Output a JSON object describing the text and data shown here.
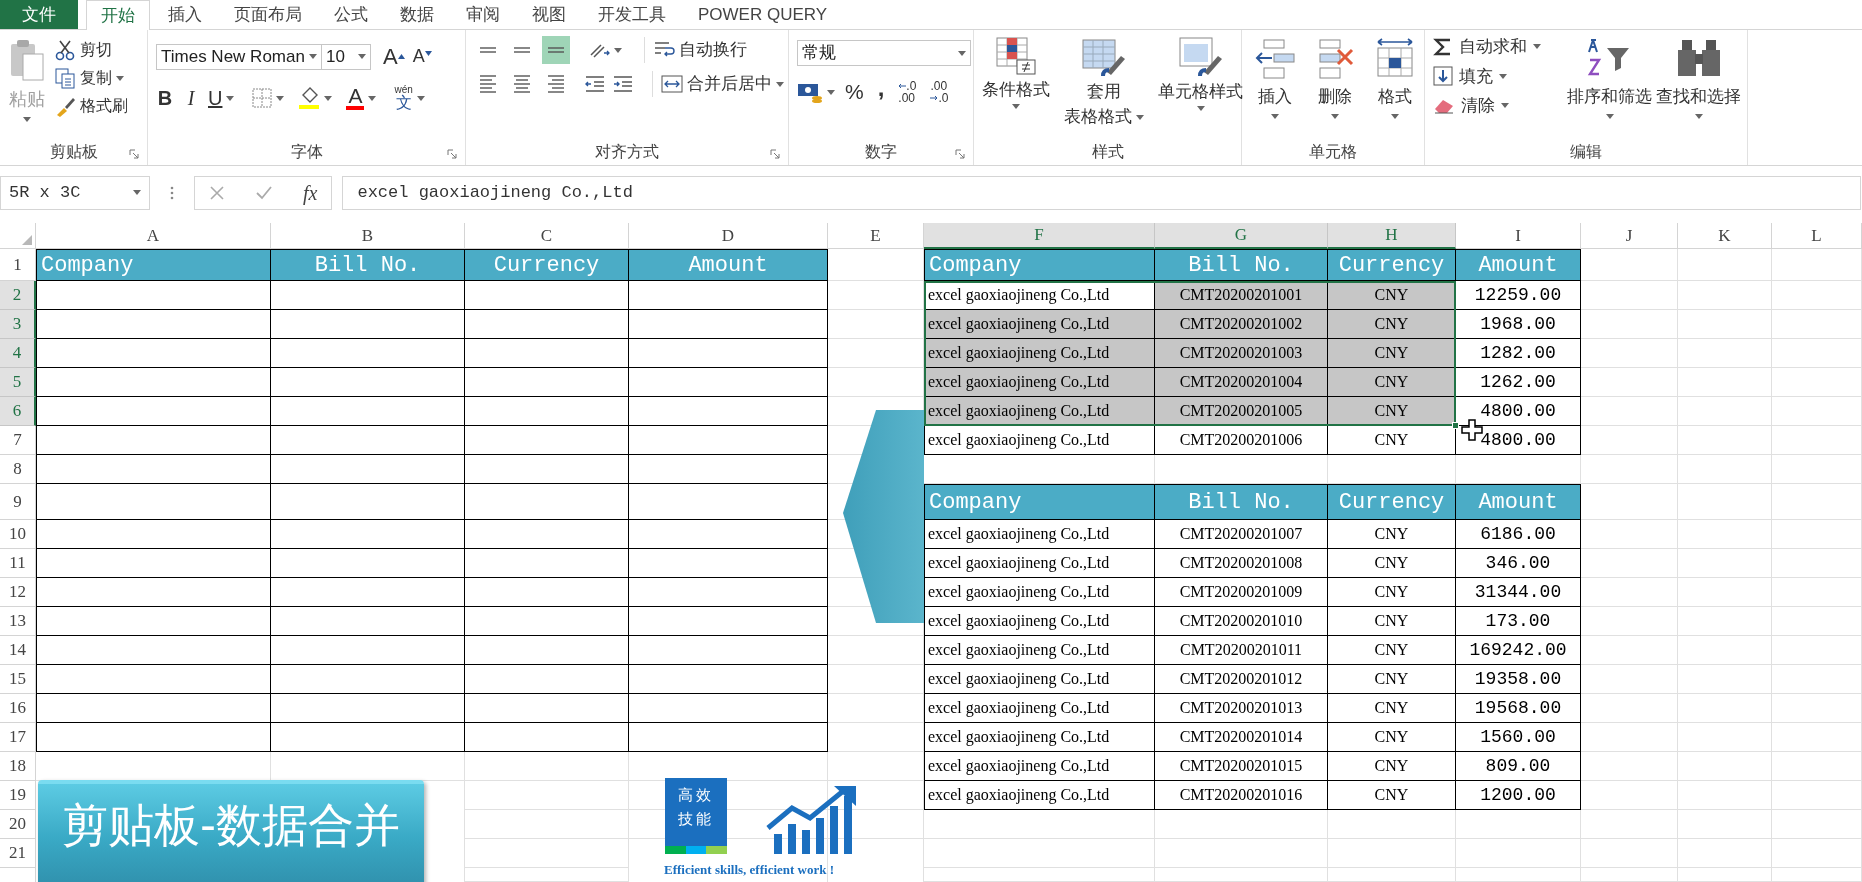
{
  "menu_tabs": [
    {
      "label": "文件",
      "kind": "file",
      "selected": false
    },
    {
      "label": "开始",
      "kind": "tab",
      "selected": true
    },
    {
      "label": "插入",
      "kind": "tab",
      "selected": false
    },
    {
      "label": "页面布局",
      "kind": "tab",
      "selected": false
    },
    {
      "label": "公式",
      "kind": "tab",
      "selected": false
    },
    {
      "label": "数据",
      "kind": "tab",
      "selected": false
    },
    {
      "label": "审阅",
      "kind": "tab",
      "selected": false
    },
    {
      "label": "视图",
      "kind": "tab",
      "selected": false
    },
    {
      "label": "开发工具",
      "kind": "tab",
      "selected": false
    },
    {
      "label": "POWER QUERY",
      "kind": "tab",
      "selected": false
    }
  ],
  "ribbon": {
    "groups": [
      {
        "kind": "clipboard",
        "label": "剪贴板",
        "dialog_launcher": true,
        "items": [
          {
            "label": "粘贴",
            "disabled": true
          },
          {
            "label": "剪切",
            "disabled": false
          },
          {
            "label": "复制",
            "disabled": false
          },
          {
            "label": "格式刷",
            "disabled": false
          }
        ]
      },
      {
        "kind": "font",
        "label": "字体",
        "dialog_launcher": true,
        "font_name": "Times New Roman",
        "font_size": "10",
        "grow": "A",
        "shrink": "A",
        "bold": "B",
        "italic": "I",
        "underline": "U",
        "font_color": "A",
        "phonetic_top": "wén",
        "phonetic_bottom": "文"
      },
      {
        "kind": "alignment",
        "label": "对齐方式",
        "dialog_launcher": true,
        "vertical_align": [
          {
            "selected": false
          },
          {
            "selected": false
          },
          {
            "selected": true
          }
        ],
        "wrap": "自动换行",
        "merge": "合并后居中"
      },
      {
        "kind": "number",
        "label": "数字",
        "dialog_launcher": true,
        "format": "常规",
        "percent": "%",
        "comma": ",",
        "decimal_buttons": [
          {
            "top": ".0",
            "bottom": ".00"
          },
          {
            "top": ".00",
            "bottom": ".0"
          }
        ]
      },
      {
        "kind": "styles",
        "label": "样式",
        "items": [
          {
            "label": "条件格式"
          },
          {
            "label": "套用",
            "label2": "表格格式"
          },
          {
            "label": "单元格样式"
          }
        ]
      },
      {
        "kind": "cells",
        "label": "单元格",
        "items": [
          {
            "label": "插入"
          },
          {
            "label": "删除"
          },
          {
            "label": "格式"
          }
        ]
      },
      {
        "kind": "editing",
        "label": "编辑",
        "small": [
          "自动求和",
          "填充",
          "清除"
        ],
        "large": [
          "排序和筛选",
          "查找和选择"
        ]
      }
    ]
  },
  "formula_bar": {
    "name_box": "5R x 3C",
    "function_button": "fx",
    "formula": "excel gaoxiaojineng Co.,Ltd"
  },
  "sheet": {
    "columns": [
      {
        "label": "A",
        "selected": false
      },
      {
        "label": "B",
        "selected": false
      },
      {
        "label": "C",
        "selected": false
      },
      {
        "label": "D",
        "selected": false
      },
      {
        "label": "E",
        "selected": false
      },
      {
        "label": "F",
        "selected": true
      },
      {
        "label": "G",
        "selected": true
      },
      {
        "label": "H",
        "selected": true
      },
      {
        "label": "I",
        "selected": false
      },
      {
        "label": "J",
        "selected": false
      },
      {
        "label": "K",
        "selected": false
      },
      {
        "label": "L",
        "selected": false
      }
    ],
    "rows": [
      {
        "label": "1",
        "selected": false
      },
      {
        "label": "2",
        "selected": true
      },
      {
        "label": "3",
        "selected": true
      },
      {
        "label": "4",
        "selected": true
      },
      {
        "label": "5",
        "selected": true
      },
      {
        "label": "6",
        "selected": true
      },
      {
        "label": "7",
        "selected": false
      },
      {
        "label": "8",
        "selected": false
      },
      {
        "label": "9",
        "selected": false
      },
      {
        "label": "10",
        "selected": false
      },
      {
        "label": "11",
        "selected": false
      },
      {
        "label": "12",
        "selected": false
      },
      {
        "label": "13",
        "selected": false
      },
      {
        "label": "14",
        "selected": false
      },
      {
        "label": "15",
        "selected": false
      },
      {
        "label": "16",
        "selected": false
      },
      {
        "label": "17",
        "selected": false
      },
      {
        "label": "18",
        "selected": false
      },
      {
        "label": "19",
        "selected": false
      },
      {
        "label": "20",
        "selected": false
      },
      {
        "label": "21",
        "selected": false
      }
    ],
    "target_table": {
      "header": [
        "Company",
        "Bill No.",
        "Currency",
        "Amount"
      ]
    },
    "source_table_1": {
      "header": [
        "Company",
        "Bill No.",
        "Currency",
        "Amount"
      ],
      "rows": [
        {
          "company": "excel gaoxiaojineng Co.,Ltd",
          "bill_no": "CMT20200201001",
          "currency": "CNY",
          "amount": "12259.00",
          "selected": true,
          "active": true
        },
        {
          "company": "excel gaoxiaojineng Co.,Ltd",
          "bill_no": "CMT20200201002",
          "currency": "CNY",
          "amount": "1968.00",
          "selected": true
        },
        {
          "company": "excel gaoxiaojineng Co.,Ltd",
          "bill_no": "CMT20200201003",
          "currency": "CNY",
          "amount": "1282.00",
          "selected": true
        },
        {
          "company": "excel gaoxiaojineng Co.,Ltd",
          "bill_no": "CMT20200201004",
          "currency": "CNY",
          "amount": "1262.00",
          "selected": true
        },
        {
          "company": "excel gaoxiaojineng Co.,Ltd",
          "bill_no": "CMT20200201005",
          "currency": "CNY",
          "amount": "4800.00",
          "selected": true
        },
        {
          "company": "excel gaoxiaojineng Co.,Ltd",
          "bill_no": "CMT20200201006",
          "currency": "CNY",
          "amount": "4800.00",
          "selected": false
        }
      ]
    },
    "source_table_2": {
      "header": [
        "Company",
        "Bill No.",
        "Currency",
        "Amount"
      ],
      "rows": [
        {
          "company": "excel gaoxiaojineng Co.,Ltd",
          "bill_no": "CMT20200201007",
          "currency": "CNY",
          "amount": "6186.00",
          "selected": false
        },
        {
          "company": "excel gaoxiaojineng Co.,Ltd",
          "bill_no": "CMT20200201008",
          "currency": "CNY",
          "amount": "346.00",
          "selected": false
        },
        {
          "company": "excel gaoxiaojineng Co.,Ltd",
          "bill_no": "CMT20200201009",
          "currency": "CNY",
          "amount": "31344.00",
          "selected": false
        },
        {
          "company": "excel gaoxiaojineng Co.,Ltd",
          "bill_no": "CMT20200201010",
          "currency": "CNY",
          "amount": "173.00",
          "selected": false
        },
        {
          "company": "excel gaoxiaojineng Co.,Ltd",
          "bill_no": "CMT20200201011",
          "currency": "CNY",
          "amount": "169242.00",
          "selected": false
        },
        {
          "company": "excel gaoxiaojineng Co.,Ltd",
          "bill_no": "CMT20200201012",
          "currency": "CNY",
          "amount": "19358.00",
          "selected": false
        },
        {
          "company": "excel gaoxiaojineng Co.,Ltd",
          "bill_no": "CMT20200201013",
          "currency": "CNY",
          "amount": "19568.00",
          "selected": false
        },
        {
          "company": "excel gaoxiaojineng Co.,Ltd",
          "bill_no": "CMT20200201014",
          "currency": "CNY",
          "amount": "1560.00",
          "selected": false
        },
        {
          "company": "excel gaoxiaojineng Co.,Ltd",
          "bill_no": "CMT20200201015",
          "currency": "CNY",
          "amount": "809.00",
          "selected": false
        },
        {
          "company": "excel gaoxiaojineng Co.,Ltd",
          "bill_no": "CMT20200201016",
          "currency": "CNY",
          "amount": "1200.00",
          "selected": false
        }
      ]
    }
  },
  "banner": {
    "text": "剪贴板-数据合并"
  },
  "logo": {
    "lines": [
      "高效",
      "技能"
    ],
    "tagline": "Efficient skills, efficient work !"
  }
}
